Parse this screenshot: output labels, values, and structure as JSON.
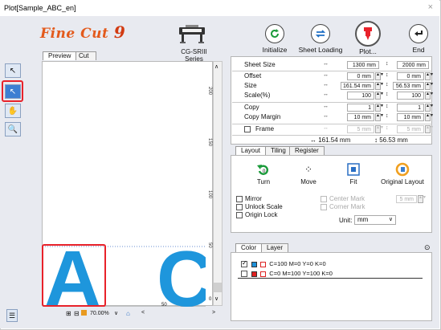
{
  "window": {
    "title": "Plot[Sample_ABC_en]",
    "close_glyph": "×"
  },
  "logo": {
    "text_a": "Fi",
    "text_b": "ne",
    "text_c": " Cut ",
    "text_d": "9"
  },
  "model": {
    "label": "CG-SRIII Series"
  },
  "toolbar": {
    "initialize_label": "Initialize",
    "sheet_loading_label": "Sheet Loading",
    "plot_label": "Plot...",
    "end_label": "End"
  },
  "preview_tabs": {
    "preview": "Preview",
    "cut_line": "Cut Line"
  },
  "canvas": {
    "letter_a": "A",
    "letter_c": "C",
    "ruler_right": [
      "200",
      "150",
      "100",
      "50"
    ],
    "ruler_bottom": [
      "50",
      "0"
    ]
  },
  "status": {
    "zoom": "70.00%"
  },
  "sheet": {
    "size_label": "Sheet Size",
    "size_w": "1300 mm",
    "size_h": "2000 mm",
    "offset_label": "Offset",
    "offset_w": "0 mm",
    "offset_h": "0 mm",
    "size2_label": "Size",
    "size2_w": "161.54 mm",
    "size2_h": "56.53 mm",
    "scale_label": "Scale(%)",
    "scale_w": "100",
    "scale_h": "100",
    "copy_label": "Copy",
    "copy_w": "1",
    "copy_h": "1",
    "copy_margin_label": "Copy Margin",
    "copy_margin_w": "10 mm",
    "copy_margin_h": "10 mm",
    "frame_label": "Frame",
    "frame_w": "5 mm",
    "frame_h": "5 mm",
    "total_w": "↔ 161.54 mm",
    "total_h": "↕ 56.53 mm"
  },
  "layout_tabs": {
    "layout": "Layout",
    "tiling": "Tiling",
    "register_mark": "Register Mark"
  },
  "layout": {
    "turn": "Turn",
    "move": "Move",
    "fit": "Fit",
    "original_layout": "Original Layout",
    "mirror": "Mirror",
    "unlock_scale": "Unlock Scale",
    "origin_lock": "Origin Lock",
    "center_mark": "Center Mark",
    "corner_mark": "Corner Mark",
    "mark_value": "5 mm",
    "unit_label": "Unit:",
    "unit_value": "mm"
  },
  "color_tabs": {
    "color": "Color",
    "layer": "Layer"
  },
  "colors": [
    {
      "label": "C=100 M=0 Y=0 K=0",
      "swatch": "#1e90d8",
      "checked": true
    },
    {
      "label": "C=0 M=100 Y=100 K=0",
      "swatch": "#e02020",
      "checked": false
    }
  ],
  "accent": {
    "highlight": "#e8222a",
    "cyan": "#1e96dc"
  }
}
